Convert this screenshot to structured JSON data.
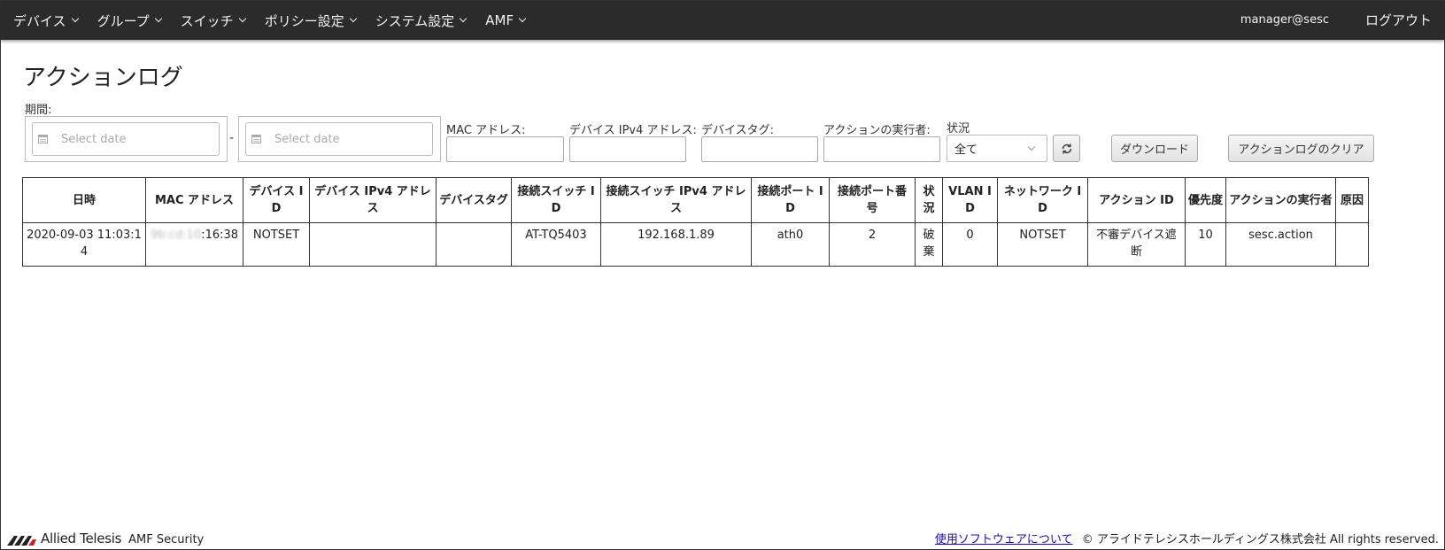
{
  "nav": {
    "items": [
      {
        "label": "デバイス"
      },
      {
        "label": "グループ"
      },
      {
        "label": "スイッチ"
      },
      {
        "label": "ポリシー設定"
      },
      {
        "label": "システム設定"
      },
      {
        "label": "AMF"
      }
    ],
    "user": "manager@sesc",
    "logout": "ログアウト"
  },
  "page": {
    "title": "アクションログ"
  },
  "filters": {
    "period_label": "期間:",
    "date_start_placeholder": "Select date",
    "date_end_placeholder": "Select date",
    "date_separator": "-",
    "mac_label": "MAC アドレス:",
    "ipv4_label": "デバイス IPv4 アドレス:",
    "tag_label": "デバイスタグ:",
    "executor_label": "アクションの実行者:",
    "status_label": "状況",
    "status_value": "全て",
    "download_button": "ダウンロード",
    "clear_button": "アクションログのクリア"
  },
  "table": {
    "headers": [
      "日時",
      "MAC アドレス",
      "デバイス ID",
      "デバイス IPv4 アドレス",
      "デバイスタグ",
      "接続スイッチ ID",
      "接続スイッチ IPv4 アドレス",
      "接続ポート ID",
      "接続ポート番号",
      "状況",
      "VLAN ID",
      "ネットワーク ID",
      "アクション ID",
      "優先度",
      "アクションの実行者",
      "原因"
    ],
    "rows": [
      {
        "datetime": "2020-09-03 11:03:14",
        "mac_hidden": "9b:cd:10",
        "mac_visible": ":16:38",
        "device_id": "NOTSET",
        "device_ipv4": "",
        "device_tag": "",
        "switch_id": "AT-TQ5403",
        "switch_ipv4": "192.168.1.89",
        "port_id": "ath0",
        "port_number": "2",
        "status": "破棄",
        "vlan_id": "0",
        "network_id": "NOTSET",
        "action_id": "不審デバイス遮断",
        "priority": "10",
        "executor": "sesc.action",
        "cause": ""
      }
    ]
  },
  "footer": {
    "brand": "Allied Telesis",
    "product": "AMF Security",
    "link": "使用ソフトウェアについて",
    "copyright": "© アライドテレシスホールディングス株式会社 All rights reserved."
  }
}
